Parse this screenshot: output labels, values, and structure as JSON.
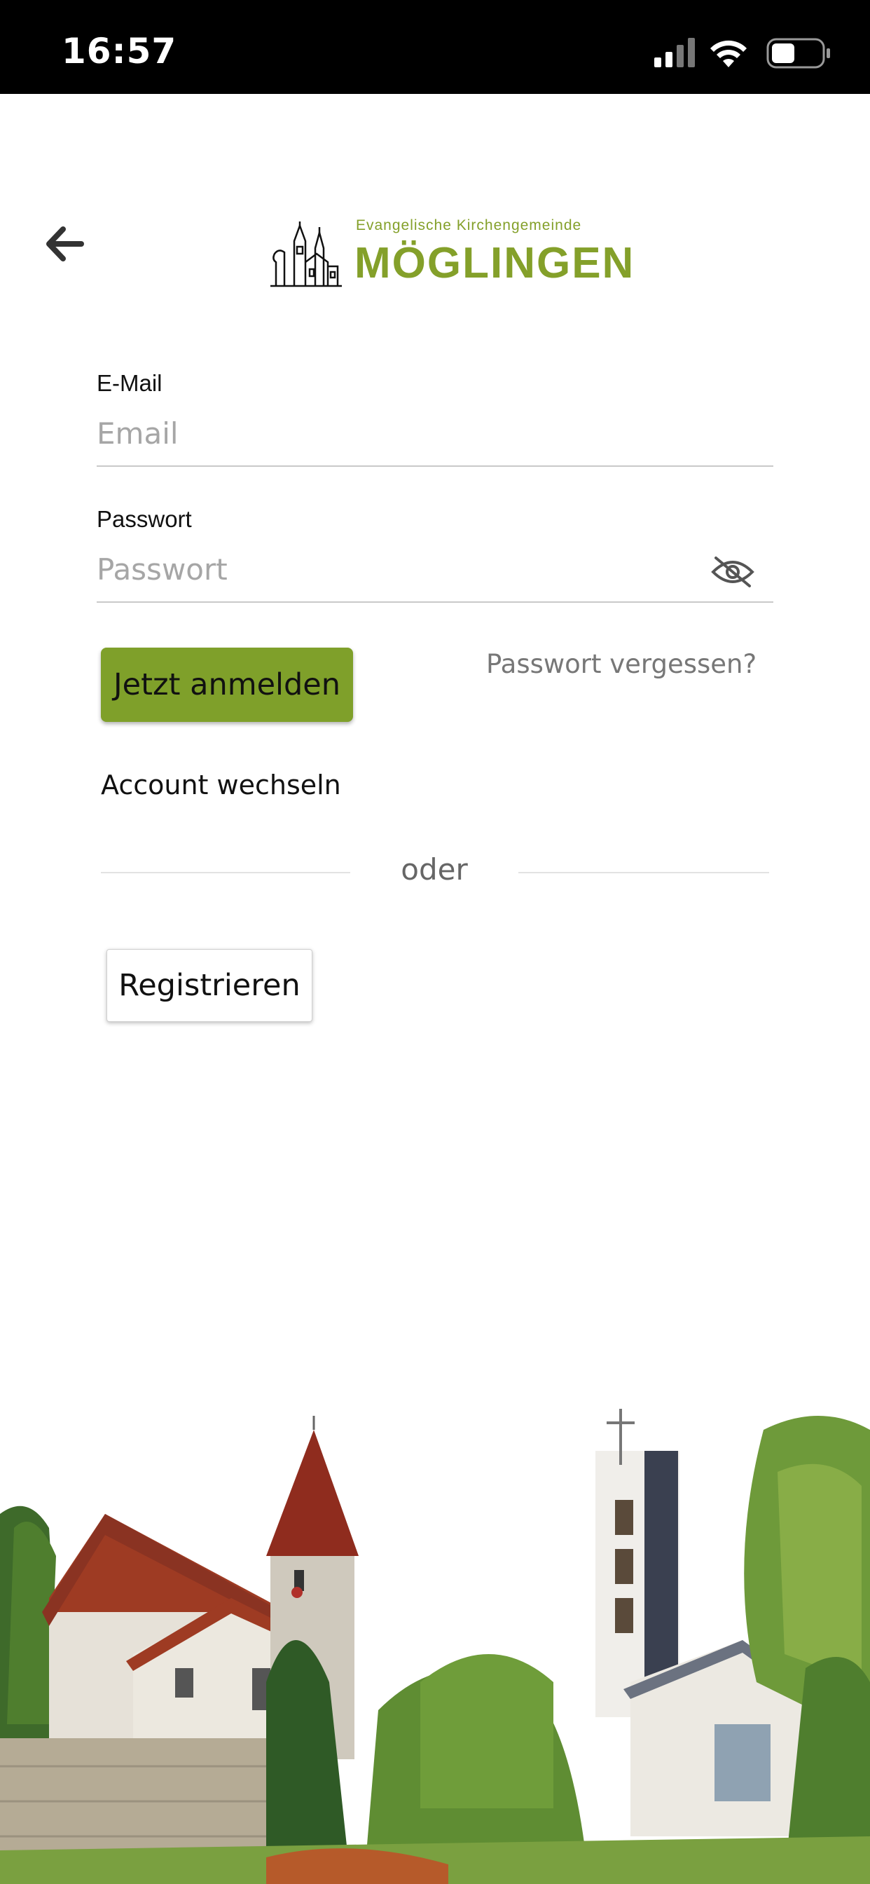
{
  "status_bar": {
    "time": "16:57",
    "icons": [
      "cellular-signal-icon",
      "wifi-icon",
      "battery-icon"
    ]
  },
  "header": {
    "back_icon": "arrow-left-icon",
    "logo": {
      "subtitle": "Evangelische Kirchengemeinde",
      "title": "MÖGLINGEN",
      "color": "#84a02a"
    }
  },
  "form": {
    "email": {
      "label": "E-Mail",
      "placeholder": "Email",
      "value": ""
    },
    "password": {
      "label": "Passwort",
      "placeholder": "Passwort",
      "value": "",
      "toggle_icon": "eye-off-icon"
    },
    "login_button": "Jetzt anmelden",
    "forgot_link": "Passwort vergessen?",
    "switch_account": "Account wechseln",
    "separator": "oder",
    "register_button": "Registrieren"
  },
  "colors": {
    "accent": "#7fa02a",
    "status_bar": "#000000"
  }
}
